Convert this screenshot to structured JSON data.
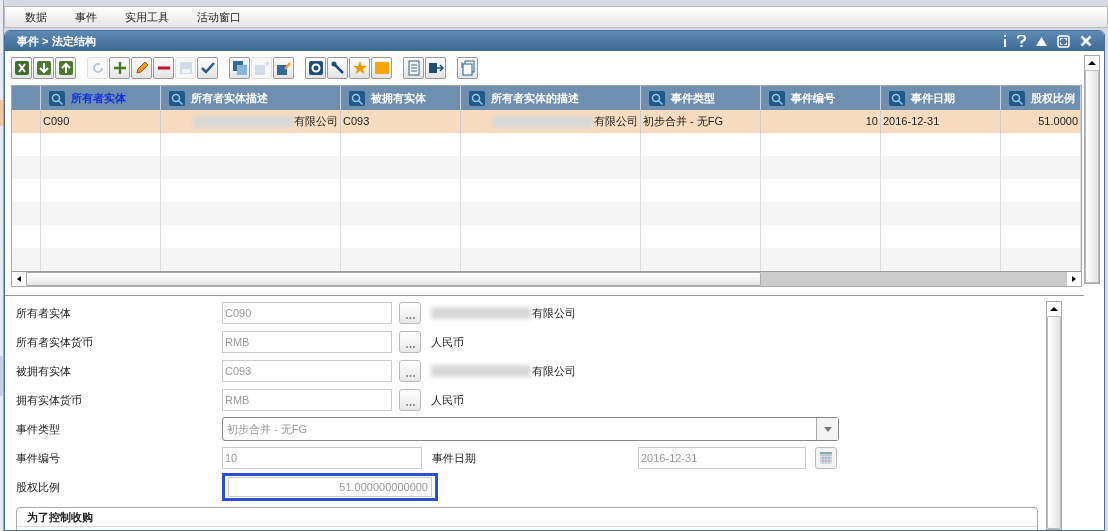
{
  "menu": [
    {
      "label": "数据"
    },
    {
      "label": "事件"
    },
    {
      "label": "实用工具"
    },
    {
      "label": "活动窗口"
    }
  ],
  "window": {
    "title": "事件 > 法定结构"
  },
  "toolbar": [
    {
      "kind": "excel",
      "disabled": false
    },
    {
      "kind": "export",
      "disabled": false
    },
    {
      "kind": "import",
      "disabled": false
    },
    {
      "kind": "sep"
    },
    {
      "kind": "refresh",
      "disabled": true
    },
    {
      "kind": "add",
      "disabled": false
    },
    {
      "kind": "edit",
      "disabled": false
    },
    {
      "kind": "remove",
      "disabled": false
    },
    {
      "kind": "save",
      "disabled": true
    },
    {
      "kind": "check",
      "disabled": false
    },
    {
      "kind": "sep"
    },
    {
      "kind": "copy",
      "disabled": false
    },
    {
      "kind": "copy-add",
      "disabled": true
    },
    {
      "kind": "copy-edit",
      "disabled": false
    },
    {
      "kind": "sep"
    },
    {
      "kind": "settings",
      "disabled": false
    },
    {
      "kind": "wrench",
      "disabled": false
    },
    {
      "kind": "star",
      "disabled": false
    },
    {
      "kind": "note",
      "disabled": false
    },
    {
      "kind": "sep"
    },
    {
      "kind": "document",
      "disabled": false
    },
    {
      "kind": "flow",
      "disabled": false
    },
    {
      "kind": "sep"
    },
    {
      "kind": "pages",
      "disabled": false
    }
  ],
  "table": {
    "columns": [
      {
        "label": "所有者实体",
        "selected": true
      },
      {
        "label": "所有者实体描述",
        "selected": false
      },
      {
        "label": "被拥有实体",
        "selected": false
      },
      {
        "label": "所有者实体的描述",
        "selected": false
      },
      {
        "label": "事件类型",
        "selected": false
      },
      {
        "label": "事件编号",
        "selected": false
      },
      {
        "label": "事件日期",
        "selected": false
      },
      {
        "label": "股权比例",
        "selected": false
      }
    ],
    "rows": [
      {
        "selected": true,
        "cells": [
          {
            "text": "C090",
            "redacted": false
          },
          {
            "text": "有限公司",
            "redacted": true
          },
          {
            "text": "C093",
            "redacted": false
          },
          {
            "text": "有限公司",
            "redacted": true
          },
          {
            "text": "初步合并 - 无FG",
            "redacted": false
          },
          {
            "text": "10",
            "redacted": false
          },
          {
            "text": "2016-12-31",
            "redacted": false
          },
          {
            "text": "51.0000",
            "redacted": false
          }
        ]
      }
    ]
  },
  "form": {
    "rows": [
      {
        "kind": "lookup",
        "label": "所有者实体",
        "value": "C090",
        "description": "有限公司",
        "redacted": true
      },
      {
        "kind": "lookup",
        "label": "所有者实体货币",
        "value": "RMB",
        "description": "人民币",
        "redacted": false
      },
      {
        "kind": "lookup",
        "label": "被拥有实体",
        "value": "C093",
        "description": "有限公司",
        "redacted": true
      },
      {
        "kind": "lookup",
        "label": "拥有实体货币",
        "value": "RMB",
        "description": "人民币",
        "redacted": false
      },
      {
        "kind": "select",
        "label": "事件类型",
        "value": "初步合并 - 无FG"
      },
      {
        "kind": "pair",
        "label": "事件编号",
        "value": "10",
        "label2": "事件日期",
        "value2": "2016-12-31"
      },
      {
        "kind": "number",
        "label": "股权比例",
        "value": "51.000000000000",
        "focused": true
      }
    ],
    "group": {
      "title": "为了控制收购"
    }
  }
}
